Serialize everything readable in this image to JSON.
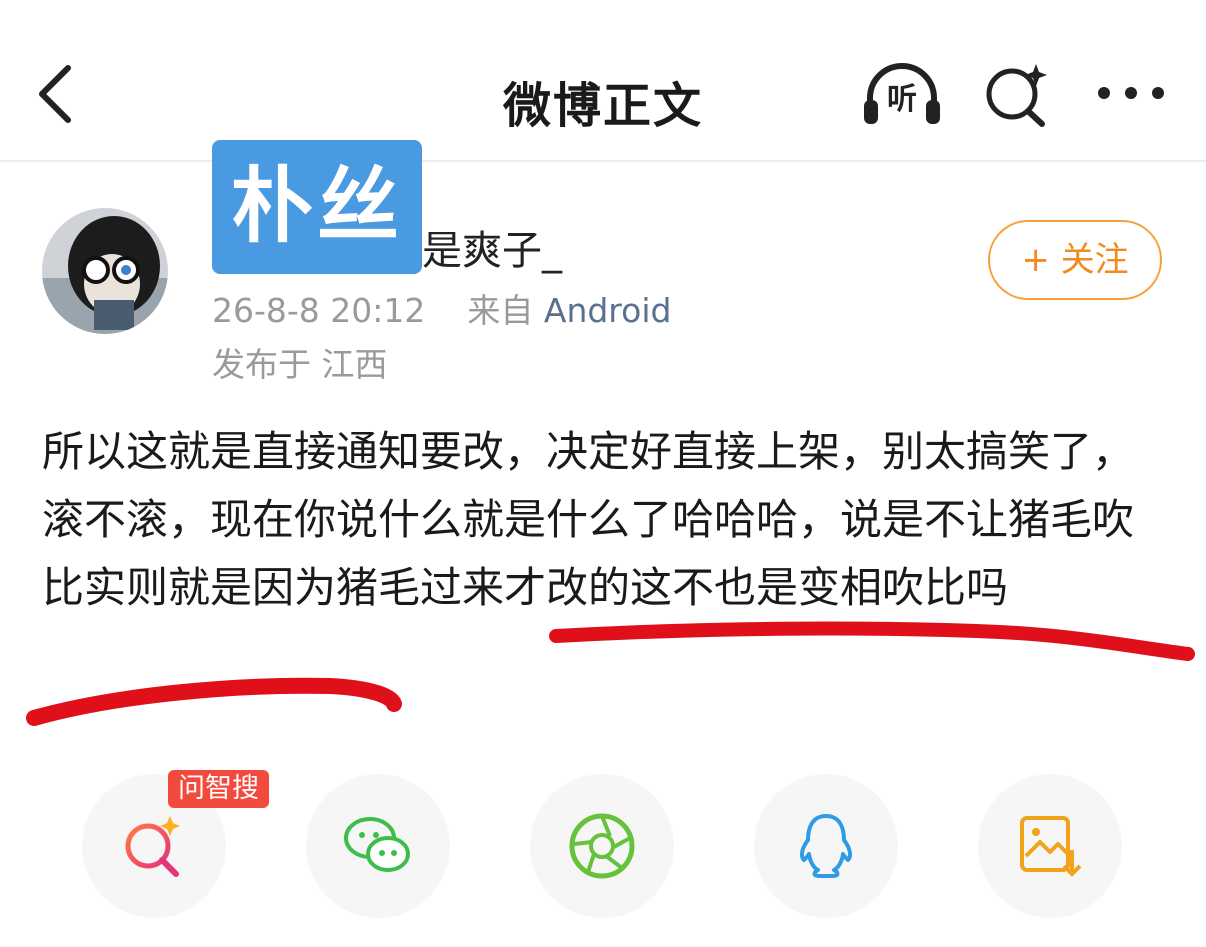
{
  "header": {
    "title": "微博正文",
    "listen_label": "听"
  },
  "post": {
    "badge_text": "朴丝",
    "username_visible": "是爽子_",
    "timestamp": "26-8-8 20:12",
    "source_prefix": "来自",
    "source": "Android",
    "location": "发布于 江西",
    "follow_label": "+ 关注",
    "content": "所以这就是直接通知要改，决定好直接上架，别太搞笑了，滚不滚，现在你说什么就是什么了哈哈哈，说是不让猪毛吹比实则就是因为猪毛过来才改的这不也是变相吹比吗"
  },
  "share": {
    "ai_tag": "问智搜",
    "items": [
      "ai-search",
      "wechat",
      "moments",
      "qq",
      "save-image"
    ]
  },
  "colors": {
    "accent_orange": "#f28b1e",
    "badge_blue": "#4a9ae2",
    "annotation_red": "#e0101a",
    "android_link": "#5b6f8f"
  }
}
